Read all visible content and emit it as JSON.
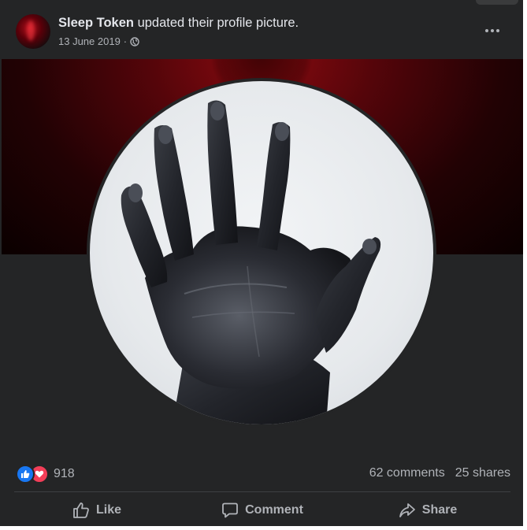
{
  "post": {
    "author": "Sleep Token",
    "action": "updated their profile picture.",
    "date": "13 June 2019",
    "separator": "·",
    "audience_icon": "globe-icon",
    "more_icon": "more-horizontal-icon"
  },
  "photo": {
    "subject": "hand-image"
  },
  "stats": {
    "reaction_icons": [
      "like-reaction-icon",
      "love-reaction-icon"
    ],
    "reaction_count": "918",
    "comments": "62 comments",
    "shares": "25 shares"
  },
  "actions": [
    {
      "label": "Like",
      "icon": "thumbs-up-icon"
    },
    {
      "label": "Comment",
      "icon": "comment-icon"
    },
    {
      "label": "Share",
      "icon": "share-icon"
    }
  ],
  "colors": {
    "background": "#242526",
    "text_primary": "#e4e6eb",
    "text_secondary": "#b0b3b8",
    "like_blue": "#1877f2",
    "love_red": "#f33e58"
  }
}
